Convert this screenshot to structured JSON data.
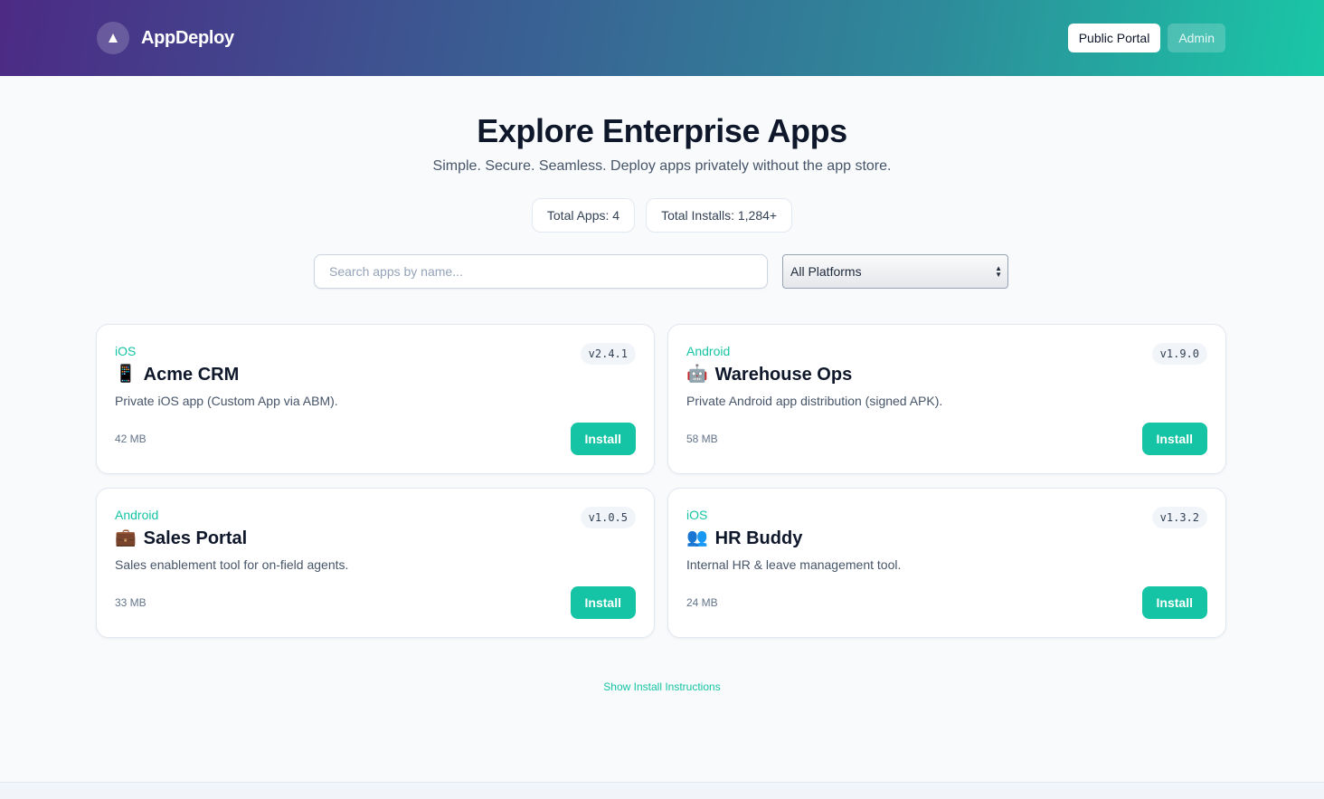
{
  "header": {
    "brand_name": "AppDeploy",
    "logo_icon": "triangle-icon",
    "nav": [
      {
        "label": "Public Portal",
        "active": true
      },
      {
        "label": "Admin",
        "active": false
      }
    ]
  },
  "hero": {
    "title": "Explore Enterprise Apps",
    "subtitle": "Simple. Secure. Seamless. Deploy apps privately without the app store."
  },
  "stats": {
    "total_apps": "Total Apps: 4",
    "total_installs": "Total Installs: 1,284+"
  },
  "filters": {
    "search_placeholder": "Search apps by name...",
    "platform_selected": "All Platforms"
  },
  "apps": [
    {
      "platform": "iOS",
      "icon": "📱",
      "name": "Acme CRM",
      "version": "v2.4.1",
      "description": "Private iOS app (Custom App via ABM).",
      "size": "42 MB",
      "install_label": "Install"
    },
    {
      "platform": "Android",
      "icon": "🤖",
      "name": "Warehouse Ops",
      "version": "v1.9.0",
      "description": "Private Android app distribution (signed APK).",
      "size": "58 MB",
      "install_label": "Install"
    },
    {
      "platform": "Android",
      "icon": "💼",
      "name": "Sales Portal",
      "version": "v1.0.5",
      "description": "Sales enablement tool for on-field agents.",
      "size": "33 MB",
      "install_label": "Install"
    },
    {
      "platform": "iOS",
      "icon": "👥",
      "name": "HR Buddy",
      "version": "v1.3.2",
      "description": "Internal HR & leave management tool.",
      "size": "24 MB",
      "install_label": "Install"
    }
  ],
  "footer": {
    "instructions_link": "Show Install Instructions"
  },
  "colors": {
    "accent": "#14c4a4",
    "header_gradient_start": "#4c2a85",
    "header_gradient_end": "#19c7a6"
  }
}
